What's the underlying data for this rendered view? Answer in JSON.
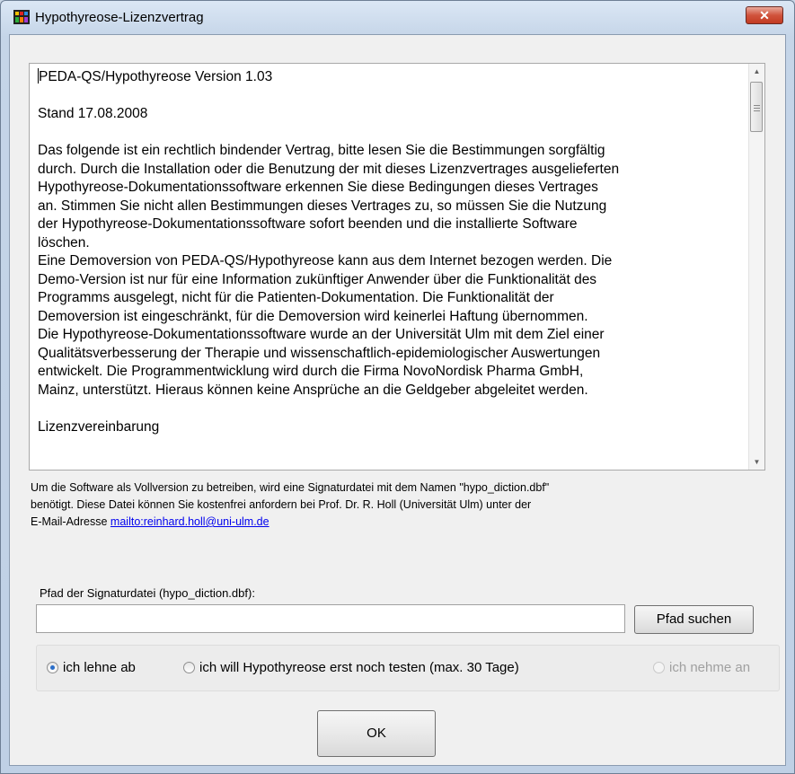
{
  "window": {
    "title": "Hypothyreose-Lizenzvertrag",
    "close_label": "✕"
  },
  "license_text": {
    "version_line": "PEDA-QS/Hypothyreose Version 1.03",
    "date_line": "Stand 17.08.2008",
    "paragraph1": "Das folgende ist ein rechtlich bindender Vertrag, bitte lesen Sie die Bestimmungen sorgfältig\ndurch. Durch die Installation oder die Benutzung der mit dieses Lizenzvertrages ausgelieferten\nHypothyreose-Dokumentationssoftware erkennen Sie diese Bedingungen dieses Vertrages\nan.  Stimmen Sie nicht allen Bestimmungen dieses Vertrages zu, so müssen Sie die Nutzung\nder Hypothyreose-Dokumentationssoftware sofort beenden und die installierte Software\nlöschen.",
    "paragraph2": "Eine Demoversion von PEDA-QS/Hypothyreose kann aus dem Internet bezogen werden. Die\nDemo-Version ist nur für eine Information zukünftiger Anwender über die Funktionalität des\nProgramms ausgelegt, nicht für die Patienten-Dokumentation.  Die Funktionalität der\nDemoversion ist eingeschränkt, für die Demoversion wird keinerlei Haftung übernommen.",
    "paragraph3": "Die Hypothyreose-Dokumentationssoftware wurde an der Universität Ulm mit dem Ziel einer\nQualitätsverbesserung der Therapie und wissenschaftlich-epidemiologischer Auswertungen\nentwickelt.  Die Programmentwicklung wird durch die Firma NovoNordisk Pharma GmbH,\nMainz, unterstützt.  Hieraus können keine Ansprüche an die Geldgeber abgeleitet werden.",
    "cut_line": "Lizenzvereinbarung"
  },
  "info": {
    "line1": "Um die Software als Vollversion zu betreiben, wird eine Signaturdatei mit dem Namen \"hypo_diction.dbf\"",
    "line2": "benötigt. Diese Datei können Sie kostenfrei anfordern bei Prof. Dr. R. Holl (Universität Ulm) unter der",
    "line3_prefix": "E-Mail-Adresse ",
    "email_link": "mailto:reinhard.holl@uni-ulm.de"
  },
  "path": {
    "label": "Pfad der Signaturdatei (hypo_diction.dbf):",
    "value": "",
    "browse_label": "Pfad suchen"
  },
  "options": [
    {
      "label": "ich lehne ab",
      "selected": true,
      "enabled": true
    },
    {
      "label": "ich will Hypothyreose erst noch testen (max. 30 Tage)",
      "selected": false,
      "enabled": true
    },
    {
      "label": "ich nehme an",
      "selected": false,
      "enabled": false
    }
  ],
  "ok_label": "OK"
}
